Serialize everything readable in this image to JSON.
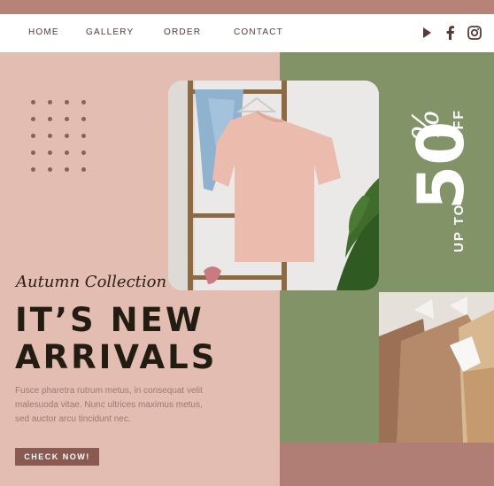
{
  "nav": {
    "items": [
      {
        "label": "HOME"
      },
      {
        "label": "GALLERY"
      },
      {
        "label": "ORDER"
      },
      {
        "label": "CONTACT"
      }
    ],
    "social_icons": [
      "play-icon",
      "facebook-icon",
      "instagram-icon"
    ]
  },
  "hero": {
    "collection_label": "Autumn Collection",
    "headline_line1": "IT’S NEW",
    "headline_line2": "ARRIVALS",
    "body_text": "Fusce pharetra rutrum metus, in consequat velit malesuoda vitae. Nunc ultrices maximus metus, sed auctor arcu tincidunt nec.",
    "cta_label": "CHECK NOW!"
  },
  "promo": {
    "prefix": "UP TO",
    "value": "50",
    "percent": "%",
    "suffix": "OFF"
  },
  "colors": {
    "pink_background": "#e3bcb2",
    "olive_green": "#829367",
    "mauve": "#b07e75",
    "button": "#8a5a52",
    "dark_text": "#221c12"
  }
}
